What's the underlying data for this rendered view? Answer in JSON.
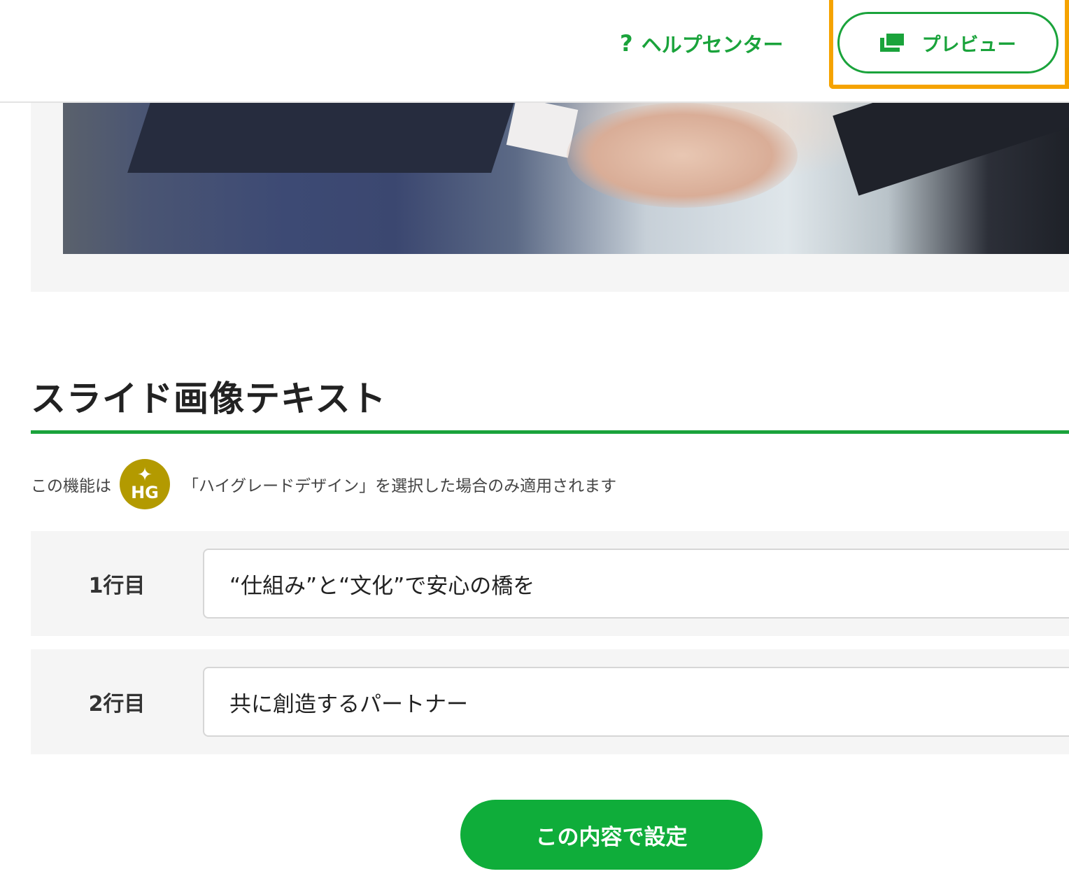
{
  "header": {
    "help_icon_glyph": "?",
    "help_label": "ヘルプセンター",
    "preview_label": "プレビュー",
    "preview_icon": "preview-windows-icon",
    "highlight_color": "#f5a300",
    "accent_color": "#1aa33b"
  },
  "section": {
    "title": "スライド画像テキスト",
    "notice_prefix": "この機能は",
    "badge_star": "✦",
    "badge_text": "HG",
    "notice_suffix": "「ハイグレードデザイン」を選択した場合のみ適用されます"
  },
  "rows": [
    {
      "label": "1行目",
      "value": "“仕組み”と“文化”で安心の橋を"
    },
    {
      "label": "2行目",
      "value": "共に創造するパートナー"
    }
  ],
  "submit": {
    "label": "この内容で設定"
  }
}
